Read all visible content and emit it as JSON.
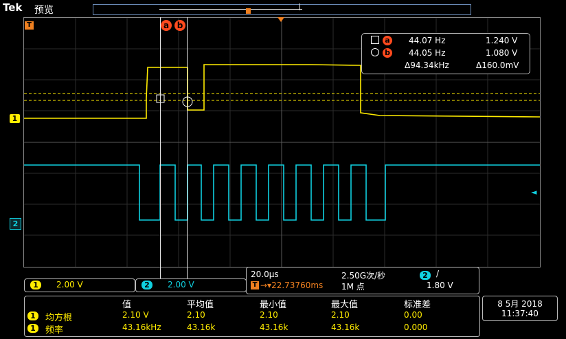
{
  "header": {
    "brand": "Tek",
    "mode": "预览"
  },
  "colors": {
    "ch1": "#ffec00",
    "ch2": "#10d0e0",
    "cursor": "#ff4a1e",
    "trigger": "#f08020"
  },
  "icons": {
    "trigger_marker": "T",
    "trigger_level_arrow": "◄"
  },
  "channels": {
    "ch1": {
      "id": "1",
      "scale": "2.00 V"
    },
    "ch2": {
      "id": "2",
      "scale": "2.00 V"
    }
  },
  "cursors": {
    "a_label": "a",
    "b_label": "b",
    "a_freq": "44.07 Hz",
    "a_volt": "1.240 V",
    "b_freq": "44.05 Hz",
    "b_volt": "1.080 V",
    "delta_freq": "Δ94.34kHz",
    "delta_volt": "Δ160.0mV"
  },
  "timebase": {
    "scale": "20.0μs",
    "sample_rate": "2.50G次/秒",
    "trigger_source": "2",
    "trigger_slope": "/",
    "trigger_offset": "22.73760ms",
    "record_length": "1M 点",
    "trigger_level": "1.80 V"
  },
  "stats": {
    "headers": [
      "值",
      "平均值",
      "最小值",
      "最大值",
      "标准差"
    ],
    "rows": [
      {
        "ch": "1",
        "name": "均方根",
        "values": [
          "2.10 V",
          "2.10",
          "2.10",
          "2.10",
          "0.00"
        ]
      },
      {
        "ch": "1",
        "name": "频率",
        "values": [
          "43.16kHz",
          "43.16k",
          "43.16k",
          "43.16k",
          "0.000"
        ]
      }
    ]
  },
  "datetime": {
    "date": "8 5月 2018",
    "time": "11:37:40"
  }
}
